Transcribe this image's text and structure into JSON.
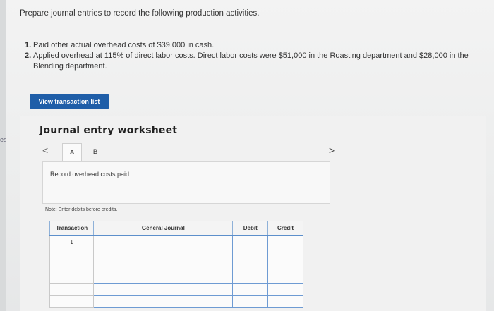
{
  "edge_text": "es",
  "prompt": "Prepare journal entries to record the following production activities.",
  "items": [
    {
      "num": "1.",
      "text": "Paid other actual overhead costs of $39,000 in cash."
    },
    {
      "num": "2.",
      "text": "Applied overhead at 115% of direct labor costs. Direct labor costs were $51,000 in the Roasting department and $28,000 in the Blending department."
    }
  ],
  "view_transaction_button": "View transaction list",
  "worksheet": {
    "title": "Journal entry worksheet",
    "nav_prev": "<",
    "nav_next": ">",
    "tabs": [
      "A",
      "B"
    ],
    "record_text": "Record overhead costs paid.",
    "note": "Note: Enter debits before credits."
  },
  "journal": {
    "headers": {
      "transaction": "Transaction",
      "general_journal": "General Journal",
      "debit": "Debit",
      "credit": "Credit"
    },
    "rows": [
      {
        "transaction": "1"
      },
      {
        "transaction": ""
      },
      {
        "transaction": ""
      },
      {
        "transaction": ""
      },
      {
        "transaction": ""
      },
      {
        "transaction": ""
      }
    ]
  }
}
